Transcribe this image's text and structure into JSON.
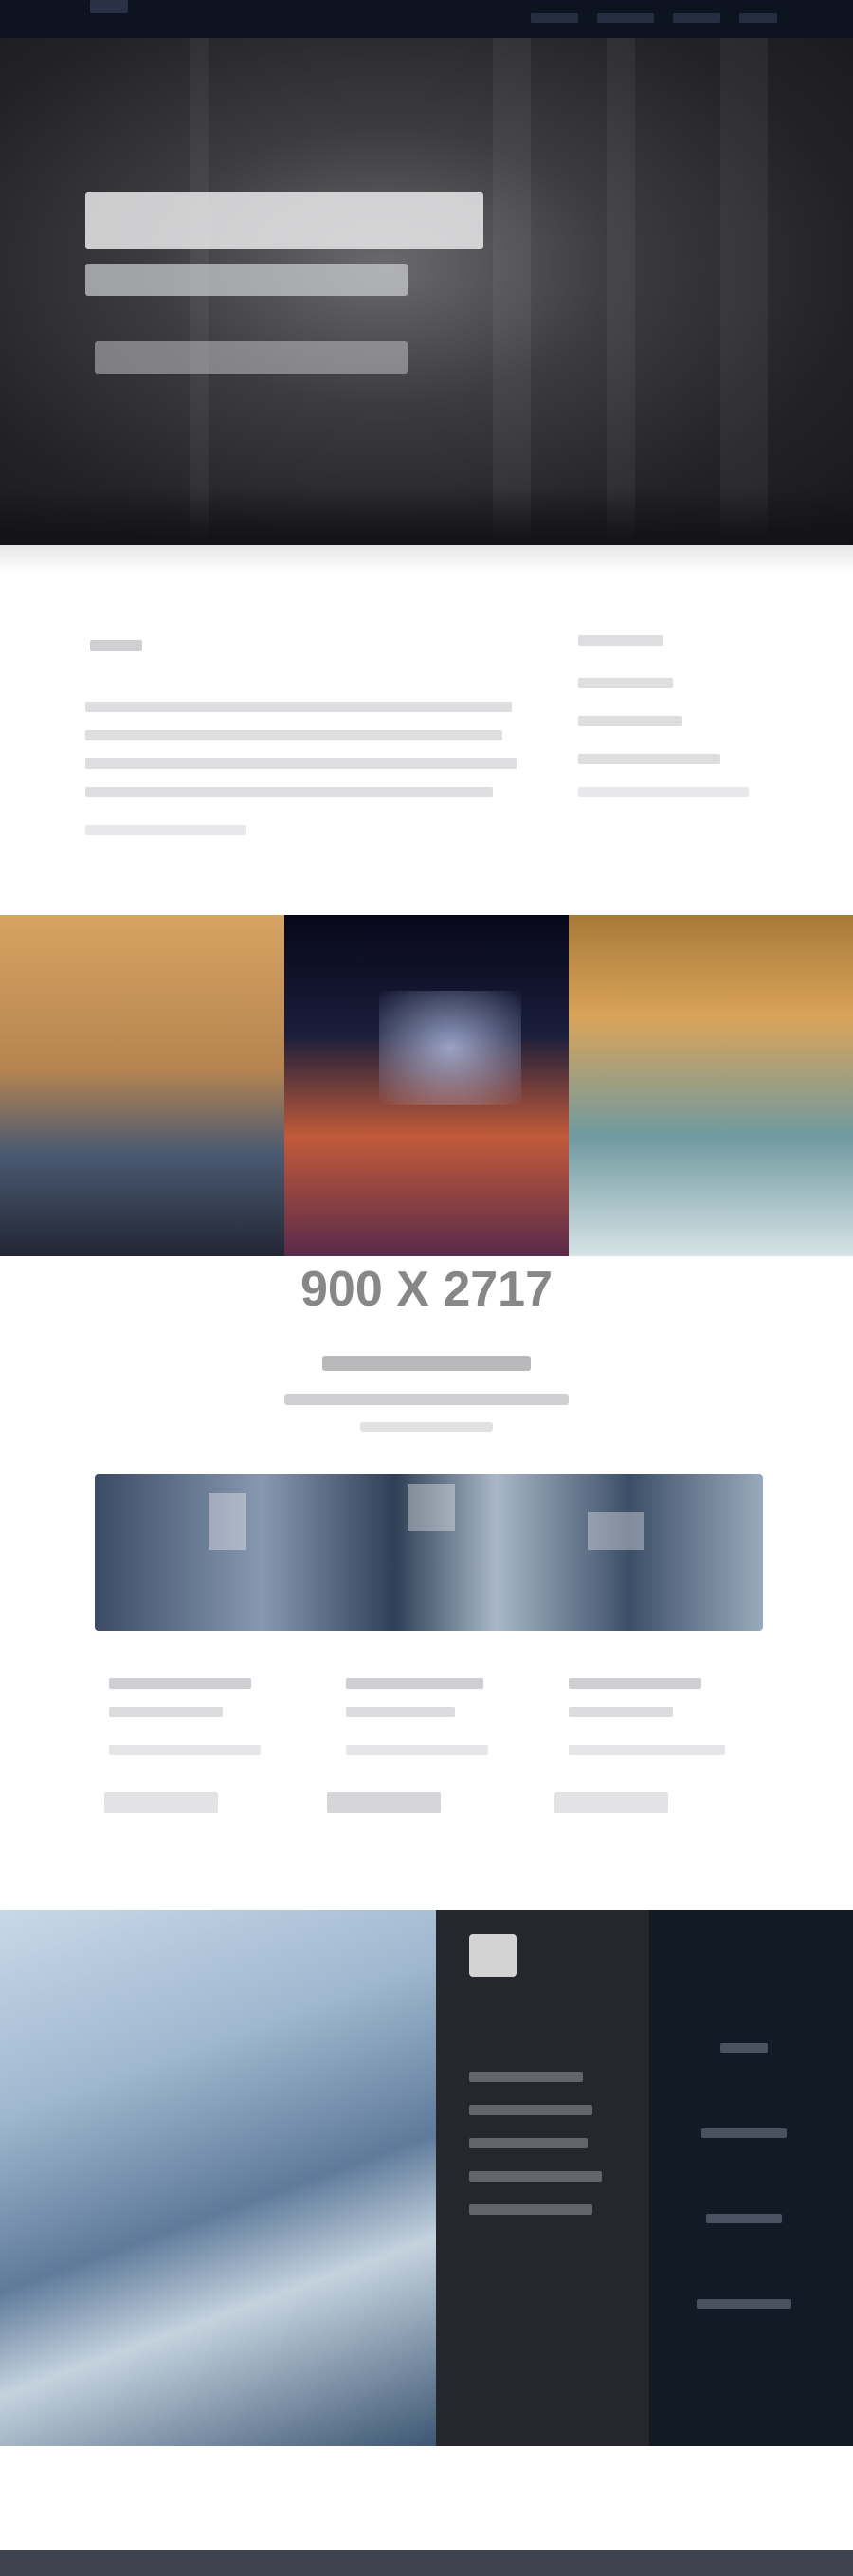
{
  "placeholder": {
    "label": "900 X 2717"
  },
  "colors": {
    "nav_bg": "#0e1322",
    "hero_bg": "#232326",
    "team_dark": "#25272c",
    "team_navy": "#121a26",
    "label_gray": "#7b7b7e"
  }
}
